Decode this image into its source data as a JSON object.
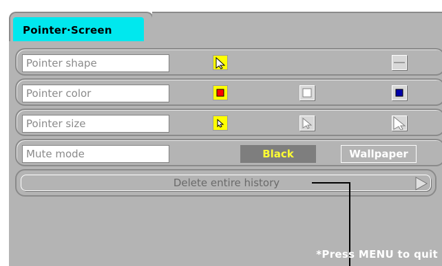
{
  "tab": {
    "label": "Pointer·Screen"
  },
  "rows": {
    "pointer_shape": {
      "label": "Pointer shape",
      "options": [
        "arrow-pointer-icon",
        "bar-pointer-icon"
      ],
      "selected": 0
    },
    "pointer_color": {
      "label": "Pointer color",
      "options": [
        "red-swatch-icon",
        "white-swatch-icon",
        "blue-swatch-icon"
      ],
      "selected": 0
    },
    "pointer_size": {
      "label": "Pointer size",
      "options": [
        "small-pointer-icon",
        "medium-pointer-icon",
        "large-pointer-icon"
      ],
      "selected": 0
    },
    "mute_mode": {
      "label": "Mute mode",
      "options": [
        "Black",
        "Wallpaper"
      ],
      "selected": 0
    }
  },
  "delete_history": {
    "label": "Delete entire history"
  },
  "footer": {
    "hint": "*Press MENU to quit"
  },
  "colors": {
    "tab_active": "#00e8ee",
    "panel": "#b4b4b4",
    "selected": "#ffff00",
    "swatch_red": "#ff0000",
    "swatch_white": "#ffffff",
    "swatch_blue": "#0000aa",
    "black_button_text": "#ffff33"
  }
}
